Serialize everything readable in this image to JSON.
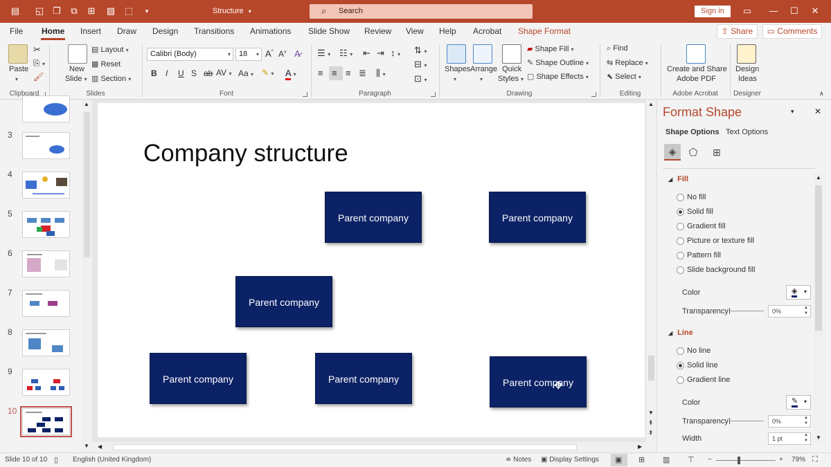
{
  "window": {
    "title": "Structure",
    "search_placeholder": "Search",
    "sign_in": "Sign in",
    "accent_color": "#b7472a"
  },
  "tabs": [
    "File",
    "Home",
    "Insert",
    "Draw",
    "Design",
    "Transitions",
    "Animations",
    "Slide Show",
    "Review",
    "View",
    "Help",
    "Acrobat",
    "Shape Format"
  ],
  "active_tab": "Home",
  "header_buttons": {
    "share": "Share",
    "comments": "Comments"
  },
  "ribbon": {
    "clipboard": {
      "label": "Clipboard",
      "paste": "Paste"
    },
    "slides": {
      "label": "Slides",
      "new_slide_1": "New",
      "new_slide_2": "Slide",
      "layout": "Layout",
      "reset": "Reset",
      "section": "Section"
    },
    "font": {
      "label": "Font",
      "font_name": "Calibri (Body)",
      "font_size": "18"
    },
    "paragraph": {
      "label": "Paragraph"
    },
    "drawing": {
      "label": "Drawing",
      "shapes": "Shapes",
      "arrange": "Arrange",
      "quick_styles_1": "Quick",
      "quick_styles_2": "Styles",
      "shape_fill": "Shape Fill",
      "shape_outline": "Shape Outline",
      "shape_effects": "Shape Effects"
    },
    "editing": {
      "label": "Editing",
      "find": "Find",
      "replace": "Replace",
      "select": "Select"
    },
    "acrobat": {
      "label": "Adobe Acrobat",
      "create_share_1": "Create and Share",
      "create_share_2": "Adobe PDF"
    },
    "designer": {
      "label": "Designer",
      "design_ideas_1": "Design",
      "design_ideas_2": "Ideas"
    }
  },
  "thumbnails": {
    "numbers": [
      "3",
      "4",
      "5",
      "6",
      "7",
      "8",
      "9",
      "10"
    ],
    "selected": "10"
  },
  "slide": {
    "title": "Company structure",
    "box_color": "#0c2266",
    "boxes": [
      "Parent company",
      "Parent company",
      "Parent company",
      "Parent company",
      "Parent company",
      "Parent company"
    ]
  },
  "format_pane": {
    "title": "Format Shape",
    "tab_shape": "Shape Options",
    "tab_text": "Text Options",
    "fill_header": "Fill",
    "fill_options": [
      "No fill",
      "Solid fill",
      "Gradient fill",
      "Picture or texture fill",
      "Pattern fill",
      "Slide background fill"
    ],
    "fill_selected": "Solid fill",
    "color_label": "Color",
    "transparency_label": "Transparency",
    "fill_transparency": "0%",
    "line_header": "Line",
    "line_options": [
      "No line",
      "Solid line",
      "Gradient line"
    ],
    "line_selected": "Solid line",
    "line_color_label": "Color",
    "line_transparency_label": "Transparency",
    "line_transparency": "0%",
    "width_label": "Width",
    "width_value": "1 pt"
  },
  "status": {
    "slide_info": "Slide 10 of 10",
    "language": "English (United Kingdom)",
    "notes": "Notes",
    "display_settings": "Display Settings",
    "zoom": "79%"
  }
}
